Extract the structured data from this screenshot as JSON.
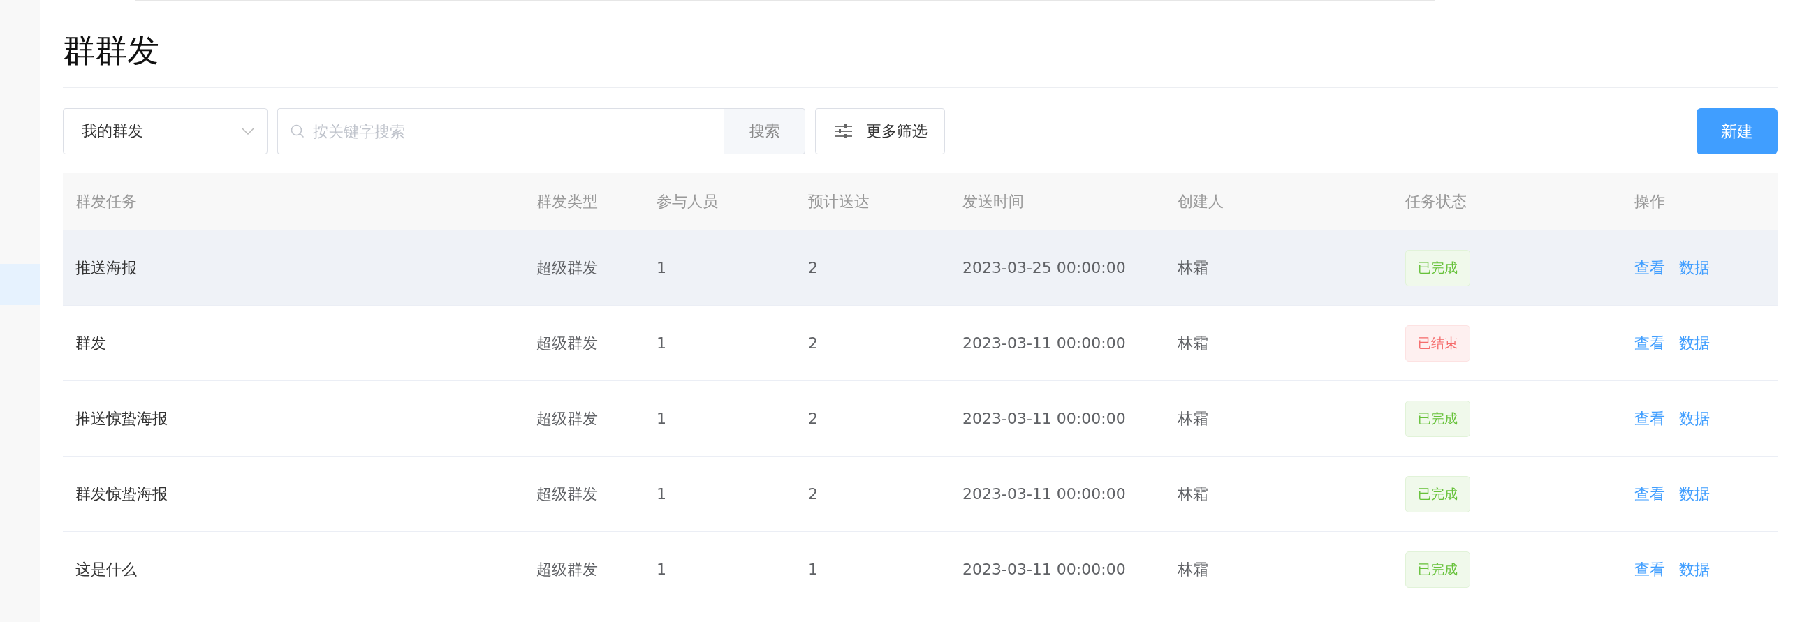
{
  "sidebar": {
    "items": [
      {
        "selected": true
      }
    ]
  },
  "page": {
    "title": "群群发"
  },
  "toolbar": {
    "scope_select": {
      "value": "我的群发"
    },
    "search": {
      "placeholder": "按关键字搜索",
      "button": "搜索"
    },
    "filter_button": "更多筛选",
    "new_button": "新建"
  },
  "table": {
    "columns": [
      "群发任务",
      "群发类型",
      "参与人员",
      "预计送达",
      "发送时间",
      "创建人",
      "任务状态",
      "操作"
    ],
    "rows": [
      {
        "highlighted": true,
        "task": "推送海报",
        "type": "超级群发",
        "participants": "1",
        "expected": "2",
        "send_time": "2023-03-25 00:00:00",
        "creator": "林霜",
        "status": {
          "kind": "done",
          "label": "已完成"
        },
        "actions": [
          "查看",
          "数据"
        ]
      },
      {
        "highlighted": false,
        "task": "群发",
        "type": "超级群发",
        "participants": "1",
        "expected": "2",
        "send_time": "2023-03-11 00:00:00",
        "creator": "林霜",
        "status": {
          "kind": "ended",
          "label": "已结束"
        },
        "actions": [
          "查看",
          "数据"
        ]
      },
      {
        "highlighted": false,
        "task": "推送惊蛰海报",
        "type": "超级群发",
        "participants": "1",
        "expected": "2",
        "send_time": "2023-03-11 00:00:00",
        "creator": "林霜",
        "status": {
          "kind": "done",
          "label": "已完成"
        },
        "actions": [
          "查看",
          "数据"
        ]
      },
      {
        "highlighted": false,
        "task": "群发惊蛰海报",
        "type": "超级群发",
        "participants": "1",
        "expected": "2",
        "send_time": "2023-03-11 00:00:00",
        "creator": "林霜",
        "status": {
          "kind": "done",
          "label": "已完成"
        },
        "actions": [
          "查看",
          "数据"
        ]
      },
      {
        "highlighted": false,
        "task": "这是什么",
        "type": "超级群发",
        "participants": "1",
        "expected": "1",
        "send_time": "2023-03-11 00:00:00",
        "creator": "林霜",
        "status": {
          "kind": "done",
          "label": "已完成"
        },
        "actions": [
          "查看",
          "数据"
        ]
      }
    ]
  }
}
